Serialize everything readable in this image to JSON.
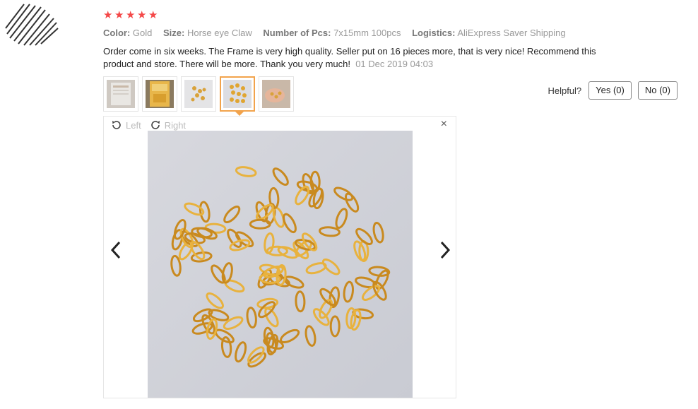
{
  "rating": {
    "stars": 5,
    "max": 5,
    "color": "#f44848"
  },
  "attributes": [
    {
      "key": "Color:",
      "value": "Gold"
    },
    {
      "key": "Size:",
      "value": "Horse eye Claw"
    },
    {
      "key": "Number of Pcs:",
      "value": "7x15mm 100pcs"
    },
    {
      "key": "Logistics:",
      "value": "AliExpress Saver Shipping"
    }
  ],
  "review": {
    "text": "Order come in six weeks. The Frame is very high quality. Seller put on 16 pieces more, that is very nice! Recommend this product and store. There will be more. Thank you very much!",
    "date": "01 Dec 2019 04:03"
  },
  "thumbnails": {
    "count": 5,
    "active_index": 3
  },
  "helpful": {
    "label": "Helpful?",
    "yes": "Yes (0)",
    "no": "No (0)"
  },
  "viewer": {
    "rotate_left": "Left",
    "rotate_right": "Right",
    "close": "×"
  },
  "colors": {
    "accent": "#f2a34c",
    "star": "#f44848",
    "gold": "#e2a533"
  },
  "icons": [
    "avatar-icon",
    "star-icon",
    "rotate-left-icon",
    "rotate-right-icon",
    "close-icon",
    "chevron-left-icon",
    "chevron-right-icon"
  ]
}
